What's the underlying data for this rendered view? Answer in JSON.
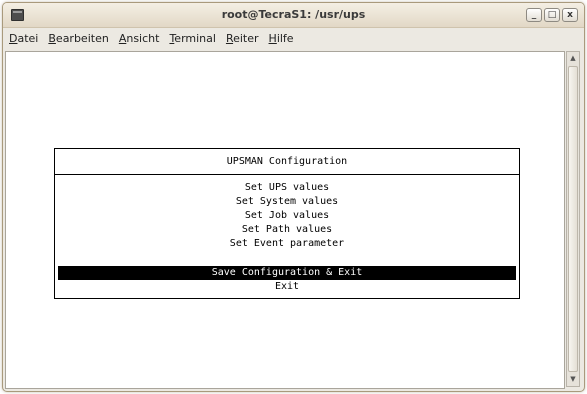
{
  "window": {
    "title": "root@TecraS1: /usr/ups",
    "buttons": {
      "minimize": "_",
      "maximize": "□",
      "close": "x"
    }
  },
  "menubar": {
    "items": [
      {
        "mnemonic": "D",
        "rest": "atei"
      },
      {
        "mnemonic": "B",
        "rest": "earbeiten"
      },
      {
        "mnemonic": "A",
        "rest": "nsicht"
      },
      {
        "mnemonic": "T",
        "rest": "erminal"
      },
      {
        "mnemonic": "R",
        "rest": "eiter"
      },
      {
        "mnemonic": "H",
        "rest": "ilfe"
      }
    ]
  },
  "dialog": {
    "title": "UPSMAN Configuration",
    "options": [
      "Set UPS values",
      "Set System values",
      "Set Job values",
      "Set Path values",
      "Set Event parameter"
    ],
    "save_exit": "Save Configuration & Exit",
    "exit": "Exit",
    "selected": "save_exit"
  },
  "icons": {
    "app": "terminal-icon",
    "scroll_up": "scroll-up-arrow-icon",
    "scroll_down": "scroll-down-arrow-icon"
  },
  "colors": {
    "terminal_bg": "#ffffff",
    "terminal_fg": "#000000",
    "selection_bg": "#000000",
    "selection_fg": "#ffffff",
    "window_frame": "#ece9e2"
  }
}
